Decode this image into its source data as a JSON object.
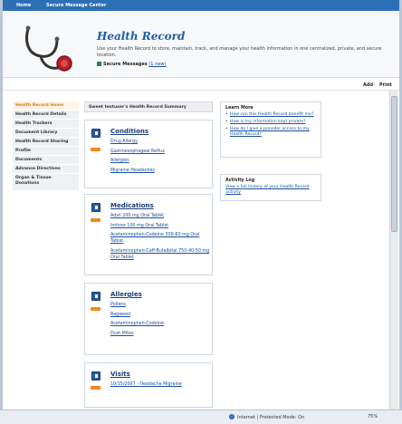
{
  "topnav": {
    "home": "Home",
    "secure_center": "Secure Message Center"
  },
  "banner": {
    "title": "Health Record",
    "description": "Use your Health Record to store, maintain, track, and manage your health information in one centralized, private, and secure location.",
    "secure_messages_label": "Secure Messages",
    "secure_messages_link": "(1 new)"
  },
  "toolbar": {
    "add": "Add",
    "sep": "|",
    "print": "Print"
  },
  "leftnav": [
    "Health Record Home",
    "Health Record Details",
    "Health Trackers",
    "Document Library",
    "Health Record Sharing",
    "Profile",
    "Documents",
    "Advance Directives",
    "Organ & Tissue Donations"
  ],
  "summary_title": "Sweet testuser's Health Record Summary",
  "cards": {
    "conditions": {
      "title": "Conditions",
      "items": [
        "Drug Allergy",
        "Gastroesophageal Reflux",
        "Allergies",
        "Migraine Headaches"
      ]
    },
    "medications": {
      "title": "Medications",
      "items": [
        "Advil 200 mg Oral Tablet",
        "Imitrex 100 mg Oral Tablet",
        "Acetaminophen-Codeine 300-60 mg Oral Tablet",
        "Acetaminophen-Caff-Butalbital 750-40-50 mg Oral Tablet"
      ]
    },
    "allergies": {
      "title": "Allergies",
      "items": [
        "Pollens",
        "Ragweed",
        "Acetaminophen-Codeine",
        "Dust Mites"
      ]
    },
    "visits": {
      "title": "Visits",
      "items": [
        "10/15/2007 - Headache Migraine"
      ]
    }
  },
  "learn_more": {
    "title": "Learn More",
    "items": [
      "How can this Health Record benefit me?",
      "How is my information kept private?",
      "How do I give a provider access to my Health Record?"
    ]
  },
  "activity_log": {
    "title": "Activity Log",
    "link": "View a full history of your Health Record activity"
  },
  "statusbar": {
    "zone": "Internet | Protected Mode: On",
    "zoom": "75%"
  },
  "colors": {
    "accent": "#2d6fb7",
    "badge": "#f08a1c",
    "link": "#1a4fa0"
  }
}
